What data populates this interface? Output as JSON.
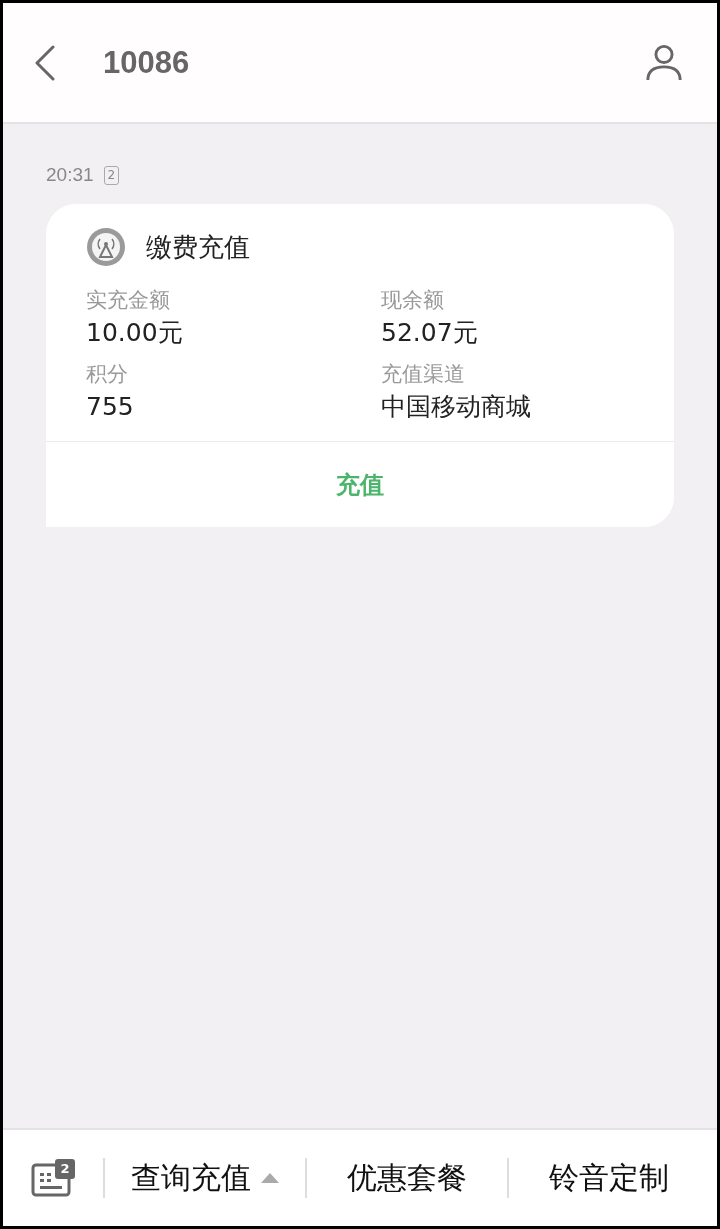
{
  "header": {
    "title": "10086"
  },
  "message": {
    "time": "20:31",
    "sim": "2",
    "card": {
      "title": "缴费充值",
      "fields": [
        {
          "label": "实充金额",
          "value": "10.00元"
        },
        {
          "label": "现余额",
          "value": "52.07元"
        },
        {
          "label": "积分",
          "value": "755"
        },
        {
          "label": "充值渠道",
          "value": "中国移动商城"
        }
      ],
      "action": "充值"
    }
  },
  "bottom_bar": {
    "sim": "2",
    "menus": [
      {
        "label": "查询充值",
        "expanded": false
      },
      {
        "label": "优惠套餐"
      },
      {
        "label": "铃音定制"
      }
    ]
  }
}
